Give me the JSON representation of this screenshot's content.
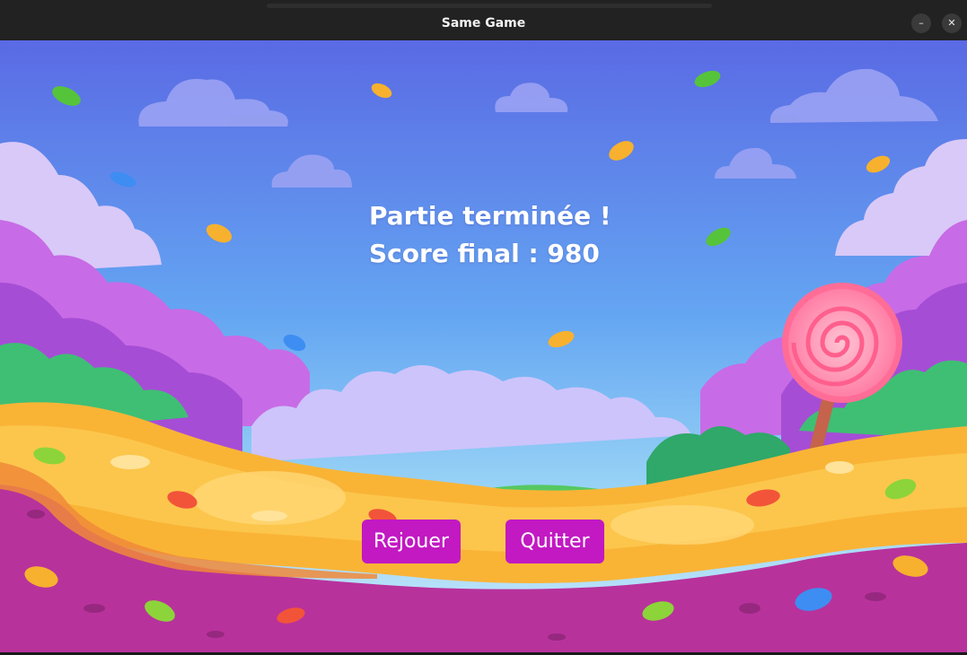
{
  "window": {
    "title": "Same Game",
    "minimize_label": "–",
    "close_label": "✕"
  },
  "game_over": {
    "line1": "Partie terminée !",
    "line2": "Score final : 980"
  },
  "buttons": {
    "replay": "Rejouer",
    "quit": "Quitter"
  },
  "colors": {
    "button_bg": "#c219c2",
    "sky_top": "#5b6fe6",
    "sky_bottom": "#8fd0f5",
    "caramel": "#f9b436",
    "purple_ground": "#b8329c"
  },
  "background_icons": [
    "cloud-icon",
    "candy-icon",
    "lollipop-icon"
  ]
}
